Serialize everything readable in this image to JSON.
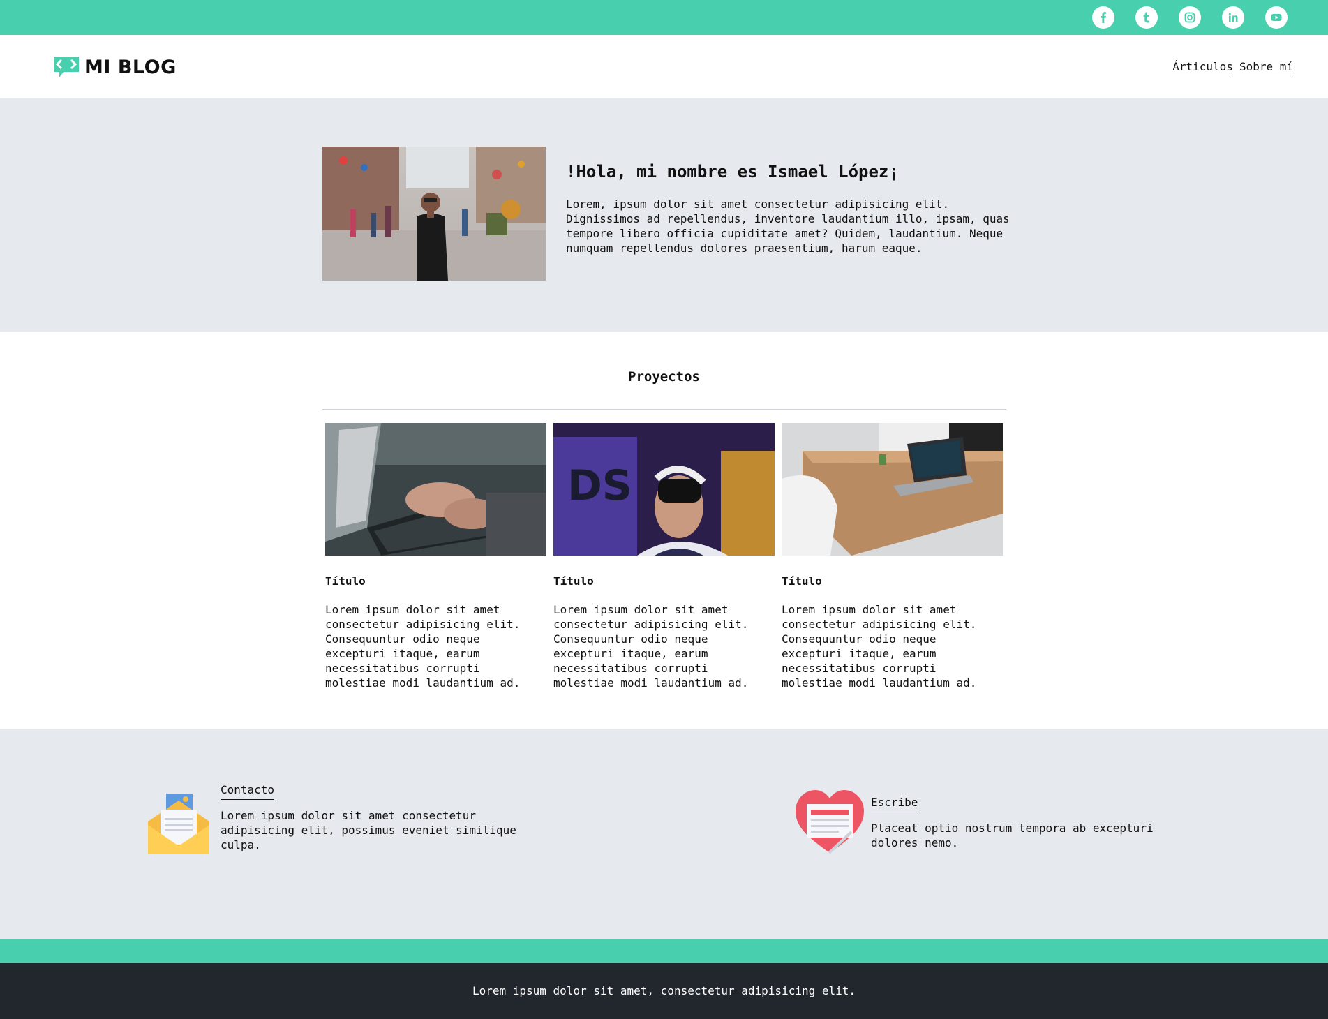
{
  "brand": {
    "name": "MI BLOG",
    "accent": "#48cfad",
    "dark": "#22262d",
    "light_bg": "#e6e9ed"
  },
  "social": [
    "facebook-icon",
    "tumblr-icon",
    "instagram-icon",
    "linkedin-icon",
    "youtube-icon"
  ],
  "nav": {
    "articles": "Árticulos",
    "about": "Sobre mí"
  },
  "hero": {
    "title": "!Hola, mi nombre es Ismael López¡",
    "text": "Lorem, ipsum dolor sit amet consectetur adipisicing elit. Dignissimos ad repellendus, inventore laudantium illo, ipsam, quas tempore libero officia cupiditate amet? Quidem, laudantium. Neque numquam repellendus dolores praesentium, harum eaque."
  },
  "projects": {
    "title": "Proyectos",
    "cards": [
      {
        "title": "Título",
        "text": "Lorem ipsum dolor sit amet consectetur adipisicing elit. Consequuntur odio neque excepturi itaque, earum necessitatibus corrupti molestiae modi laudantium ad."
      },
      {
        "title": "Título",
        "text": "Lorem ipsum dolor sit amet consectetur adipisicing elit. Consequuntur odio neque excepturi itaque, earum necessitatibus corrupti molestiae modi laudantium ad."
      },
      {
        "title": "Título",
        "text": "Lorem ipsum dolor sit amet consectetur adipisicing elit. Consequuntur odio neque excepturi itaque, earum necessitatibus corrupti molestiae modi laudantium ad."
      }
    ]
  },
  "contact": {
    "title": "Contacto",
    "text": "Lorem ipsum dolor sit amet consectetur adipisicing elit, possimus eveniet similique culpa."
  },
  "write": {
    "title": "Escribe",
    "text": "Placeat optio nostrum tempora ab excepturi dolores nemo."
  },
  "footer": {
    "text": "Lorem ipsum dolor sit amet, consectetur adipisicing elit."
  }
}
